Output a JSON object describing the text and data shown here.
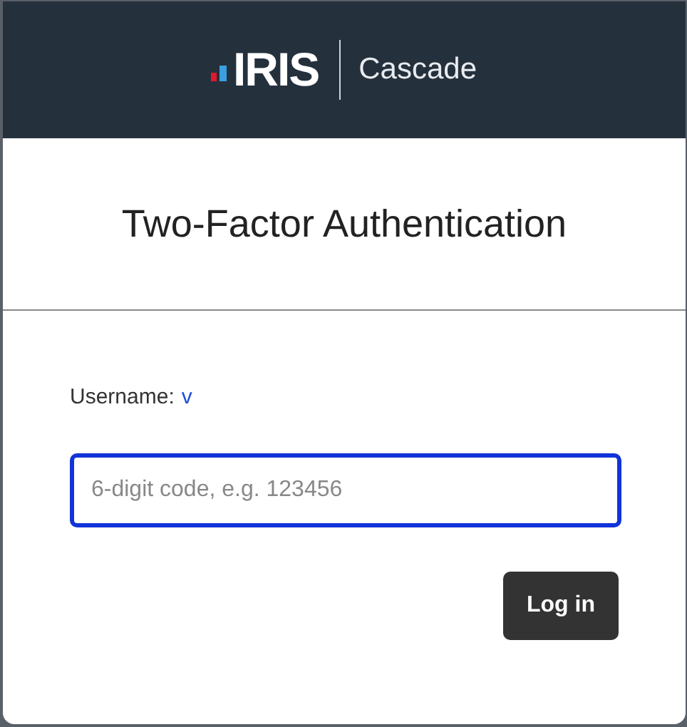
{
  "header": {
    "logo_text": "IRIS",
    "product": "Cascade"
  },
  "title": "Two-Factor Authentication",
  "username": {
    "label": "Username:",
    "value": "v"
  },
  "code_field": {
    "placeholder": "6-digit code, e.g. 123456",
    "focused": true
  },
  "buttons": [
    "Log in"
  ]
}
